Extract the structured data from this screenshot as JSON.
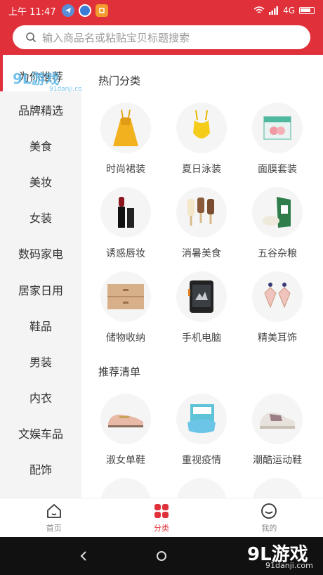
{
  "status_bar": {
    "time": "上午 11:47",
    "network": "4G"
  },
  "search": {
    "placeholder": "输入商品名或粘贴宝贝标题搜索"
  },
  "sidebar": {
    "items": [
      {
        "label": "为你推荐",
        "active": true
      },
      {
        "label": "品牌精选"
      },
      {
        "label": "美食"
      },
      {
        "label": "美妆"
      },
      {
        "label": "女装"
      },
      {
        "label": "数码家电"
      },
      {
        "label": "居家日用"
      },
      {
        "label": "鞋品"
      },
      {
        "label": "男装"
      },
      {
        "label": "内衣"
      },
      {
        "label": "文娱车品"
      },
      {
        "label": "配饰"
      }
    ]
  },
  "main": {
    "hot_title": "热门分类",
    "hot_items": [
      {
        "label": "时尚裙装",
        "icon": "dress-icon"
      },
      {
        "label": "夏日泳装",
        "icon": "swimsuit-icon"
      },
      {
        "label": "面膜套装",
        "icon": "facemask-box-icon"
      },
      {
        "label": "诱惑唇妆",
        "icon": "lipstick-icon"
      },
      {
        "label": "消暑美食",
        "icon": "popsicle-icon"
      },
      {
        "label": "五谷杂粮",
        "icon": "rice-bag-icon"
      },
      {
        "label": "储物收纳",
        "icon": "drawer-box-icon"
      },
      {
        "label": "手机电脑",
        "icon": "rugged-phone-icon"
      },
      {
        "label": "精美耳饰",
        "icon": "earrings-icon"
      }
    ],
    "rec_title": "推荐清单",
    "rec_items": [
      {
        "label": "淑女单鞋",
        "icon": "loafer-shoe-icon"
      },
      {
        "label": "重视疫情",
        "icon": "mask-box-icon"
      },
      {
        "label": "潮酷运动鞋",
        "icon": "sneaker-icon"
      }
    ]
  },
  "tabbar": {
    "home": "首页",
    "category": "分类",
    "mine": "我的"
  },
  "watermark": {
    "brand": "9L游戏",
    "site": "91danji.com"
  },
  "colors": {
    "accent": "#e0303a",
    "sidebar_bg": "#f4f4f4"
  }
}
